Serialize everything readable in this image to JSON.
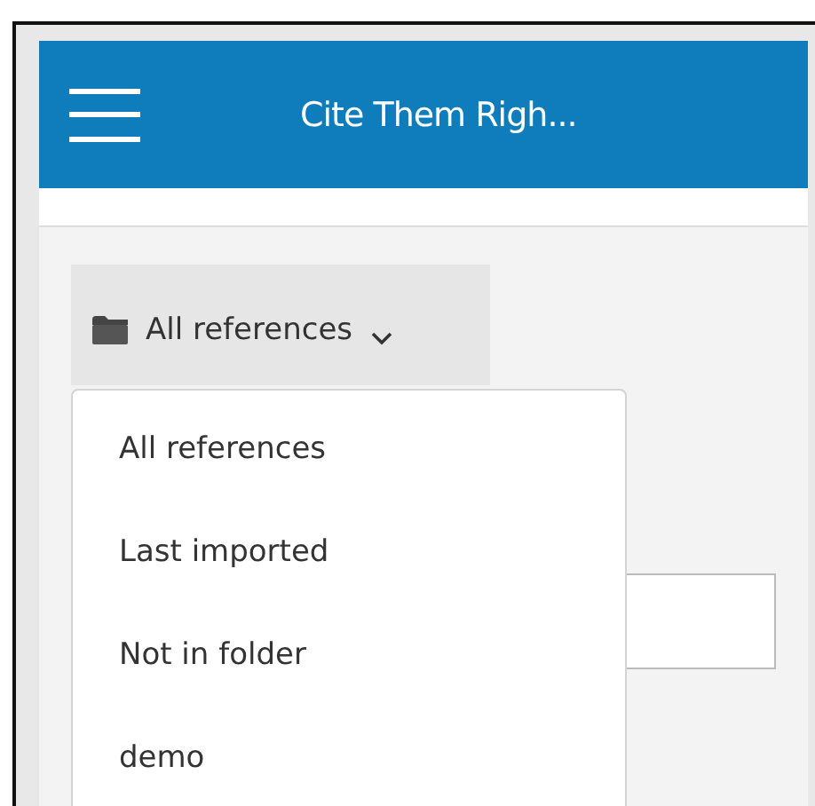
{
  "header": {
    "title": "Cite Them Righ..."
  },
  "folder_dropdown": {
    "value": "All references",
    "expanded": true,
    "options": [
      {
        "label": "All references"
      },
      {
        "label": "Last imported"
      },
      {
        "label": "Not in folder"
      },
      {
        "label": "demo"
      }
    ]
  }
}
